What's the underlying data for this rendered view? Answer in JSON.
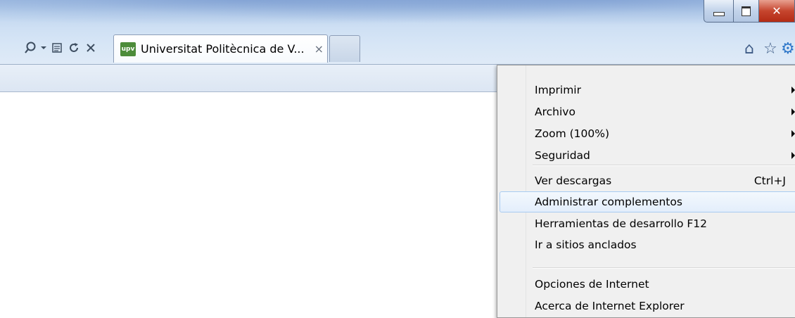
{
  "toolbar": {
    "search_icon": "magnifier-icon",
    "search_dropdown_icon": "dropdown-arrow-icon",
    "compat_icon": "compatibility-view-icon",
    "refresh_icon": "refresh-icon",
    "stop_icon": "stop-icon"
  },
  "tab": {
    "favicon_text": "upv",
    "title": "Universitat Politècnica de V...",
    "close": "×"
  },
  "window": {
    "close": "✕"
  },
  "right_icons": {
    "home": "⌂",
    "favorites": "☆",
    "tools": "⚙"
  },
  "menu": {
    "items": [
      {
        "label": "Imprimir"
      },
      {
        "label": "Archivo"
      },
      {
        "label": "Zoom (100%)"
      },
      {
        "label": "Seguridad"
      },
      {
        "label": "Ver descargas",
        "shortcut": "Ctrl+J"
      },
      {
        "label": "Administrar complementos"
      },
      {
        "label": "Herramientas de desarrollo F12"
      },
      {
        "label": "Ir a sitios anclados"
      },
      {
        "label": "Opciones de Internet"
      },
      {
        "label": "Acerca de Internet Explorer"
      }
    ]
  },
  "colors": {
    "menu_background": "#f0f0f0",
    "menu_highlight_border": "#a8cbf1",
    "close_button": "#c6452e",
    "favicon": "#4c8c3a"
  }
}
